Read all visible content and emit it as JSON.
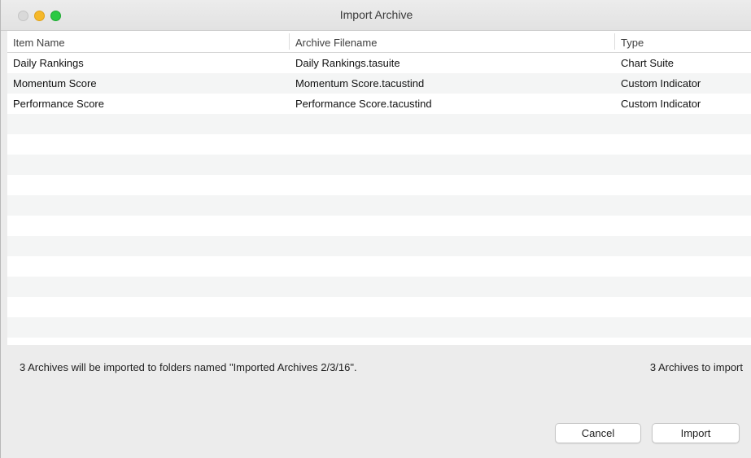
{
  "window": {
    "title": "Import Archive"
  },
  "table": {
    "columns": [
      "Item Name",
      "Archive Filename",
      "Type"
    ],
    "rows": [
      {
        "name": "Daily Rankings",
        "filename": "Daily Rankings.tasuite",
        "type": "Chart Suite"
      },
      {
        "name": "Momentum Score",
        "filename": "Momentum Score.tacustind",
        "type": "Custom Indicator"
      },
      {
        "name": "Performance Score",
        "filename": "Performance Score.tacustind",
        "type": "Custom Indicator"
      }
    ],
    "empty_row_count": 11
  },
  "status": {
    "message": "3 Archives will be imported to folders named \"Imported Archives 2/3/16\".",
    "count": "3 Archives to import"
  },
  "buttons": {
    "cancel": "Cancel",
    "import": "Import"
  }
}
